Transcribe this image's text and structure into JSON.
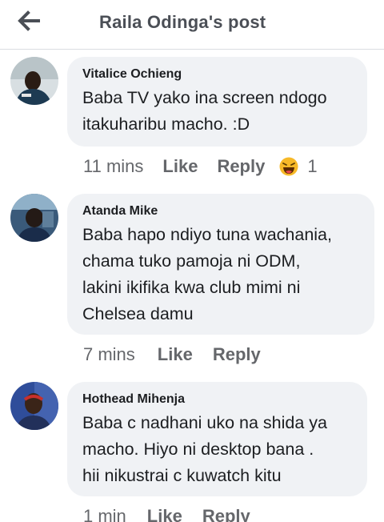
{
  "header": {
    "title": "Raila Odinga's post"
  },
  "comments": [
    {
      "author": "Vitalice Ochieng",
      "text": "Baba TV yako ina screen ndogo\nitakuharibu macho. :D",
      "time": "11 mins",
      "like_label": "Like",
      "reply_label": "Reply",
      "reaction_icon": "laughing-emoji-icon",
      "reaction_count": "1"
    },
    {
      "author": "Atanda Mike",
      "text": "Baba hapo ndiyo tuna wachania,\nchama tuko pamoja ni ODM,\nlakini ikifika kwa club mimi ni\nChelsea damu",
      "time": "7 mins",
      "like_label": "Like",
      "reply_label": "Reply"
    },
    {
      "author": "Hothead Mihenja",
      "text": "Baba c nadhani uko na shida ya\nmacho. Hiyo ni desktop bana  .\nhii nikustrai c kuwatch kitu",
      "time": "1 min",
      "like_label": "Like",
      "reply_label": "Reply"
    }
  ],
  "colors": {
    "bubble": "#f0f2f5",
    "meta": "#65676b",
    "text": "#1c1e21",
    "header_title": "#4b4f56"
  }
}
